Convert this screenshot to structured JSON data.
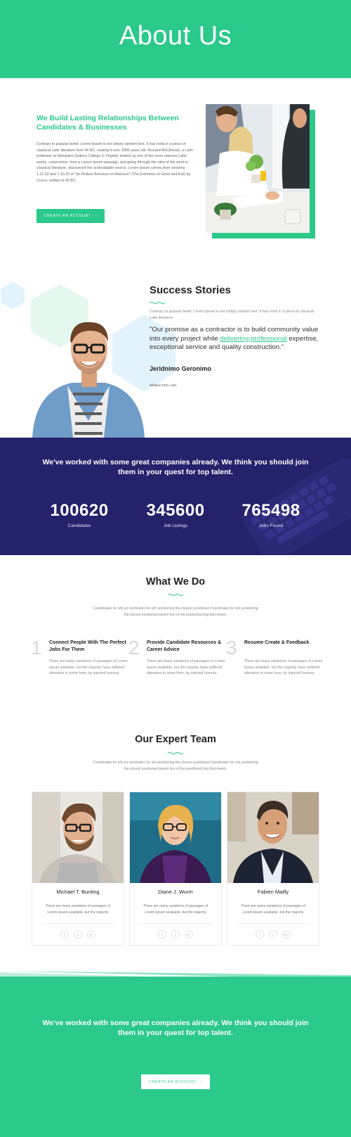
{
  "hero": {
    "title": "About Us"
  },
  "about": {
    "heading": "We Build Lasting Relationships Between Candidates & Businesses",
    "body": "Contrary to popular belief, Lorem Ipsum is not simply random text. It has roots in a piece of classical Latin literature from 45 BC, making it over 2000 years old. Richard McClintock, a Latin professor at Hampden-Sydney College in Virginia, looked up one of the more obscure Latin words, consectetur, from a Lorem Ipsum passage, and going through the cites of the word in classical literature, discovered the undoubtable source. Lorem Ipsum comes from sections 1.10.32 and 1.10.33 of \"de Finibus Bonorum et Malorum\" (The Extremes of Good and Evil) by Cicero, written in 45 BC.",
    "button_label": "CREATE AN ACCOUNT",
    "button_icon": "chevron-right-icon"
  },
  "success": {
    "title": "Success Stories",
    "sub": "Contrary to popular belief, Lorem Ipsum is not simply random text. It has roots in a piece of classical Latin literature",
    "quote_before": "\"Our promise as a contractor is to build community value into every project while ",
    "quote_link": "delivering professional",
    "quote_after": " expertise, exceptional service and quality construction.\"",
    "name": "Jeridnimo Geronimo",
    "role": "Whilans CEO, USA"
  },
  "stats": {
    "headline": "We've worked with some great companies already. We think you should join them in your quest for top talent.",
    "items": [
      {
        "value": "100620",
        "label": "Candidates"
      },
      {
        "value": "345600",
        "label": "Job Listings"
      },
      {
        "value": "765498",
        "label": "Jobs Found"
      }
    ]
  },
  "what_we_do": {
    "title": "What We Do",
    "sub": "Coordinates for sits po nordinates for sits positioning the closest positioned Coordinates for sits positioning the closest positioned parent box of the positioned ting that meets.",
    "features": [
      {
        "num": "1",
        "title": "Connect People With The Perfect Jobs For Them",
        "body": "There are many variations of passages of Lorem Ipsum available, but the majority have suffered alteration in some form, by injected humour."
      },
      {
        "num": "2",
        "title": "Provide Candidate Resources & Career Advice",
        "body": "There are many variations of passages of Lorem Ipsum available, but the majority have suffered alteration in some form, by injected humour."
      },
      {
        "num": "3",
        "title": "Resume Create & Feedback",
        "body": "There are many variations of passages of Lorem Ipsum available, but the majority have suffered alteration in some form, by injected humour."
      }
    ]
  },
  "team": {
    "title": "Our Expert Team",
    "sub": "Coordinates for sits po nordinates for sits positioning the closest positioned Coordinates for sits positioning the closest positioned parent box of the positioned ting that meets.",
    "members": [
      {
        "name": "Michael T. Bunting",
        "body": "There are many variations of passages of Lorem Ipsum available, but the majority"
      },
      {
        "name": "Diane J. Wurm",
        "body": "There are many variations of passages of Lorem Ipsum available, but the majority"
      },
      {
        "name": "Fabien Mailly",
        "body": "There are many variations of passages of Lorem Ipsum available, but the majority"
      }
    ],
    "social": [
      "f",
      "t",
      "G+"
    ]
  },
  "cta": {
    "headline": "We've worked with some great companies already. We think you should join them in your quest for top talent.",
    "button_label": "CREATE AN ACCOUNT"
  },
  "colors": {
    "accent": "#2bc98a",
    "navy": "#24226b",
    "hex_green": "#e5f8ef",
    "hex_blue": "#e3f3fc"
  }
}
